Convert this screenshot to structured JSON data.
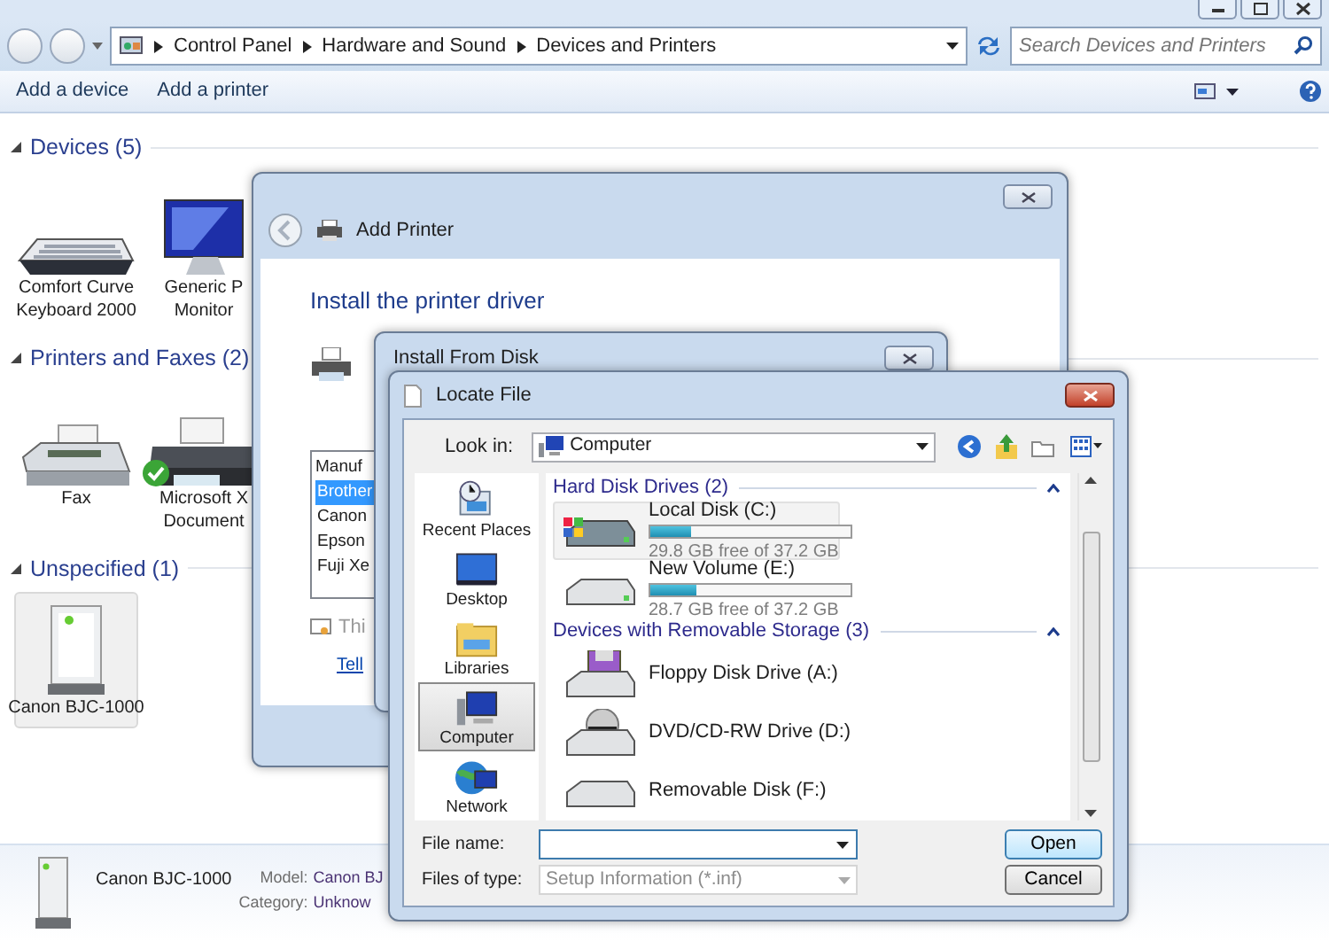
{
  "explorer": {
    "breadcrumb": [
      "Control Panel",
      "Hardware and Sound",
      "Devices and Printers"
    ],
    "search": {
      "placeholder": "Search Devices and Printers"
    },
    "toolbar": [
      "Add a device",
      "Add a printer"
    ],
    "groups": [
      {
        "title": "Devices (5)",
        "expanded": true,
        "items": [
          {
            "lines": [
              "Comfort Curve",
              "Keyboard 2000"
            ],
            "kind": "keyboard",
            "selected": false,
            "default": false
          },
          {
            "lines": [
              "Generic P",
              "Monitor"
            ],
            "kind": "monitor",
            "selected": false,
            "default": false
          }
        ]
      },
      {
        "title": "Printers and Faxes (2)",
        "expanded": true,
        "items": [
          {
            "lines": [
              "Fax"
            ],
            "kind": "fax",
            "selected": false,
            "default": false
          },
          {
            "lines": [
              "Microsoft X",
              "Document"
            ],
            "kind": "printer",
            "selected": false,
            "default": true
          }
        ]
      },
      {
        "title": "Unspecified (1)",
        "expanded": true,
        "items": [
          {
            "lines": [
              "Canon BJC-1000"
            ],
            "kind": "tower",
            "selected": true,
            "default": false
          }
        ]
      }
    ],
    "details": {
      "name": "Canon BJC-1000",
      "fields": [
        {
          "label": "Model:",
          "value": "Canon BJ"
        },
        {
          "label": "Category:",
          "value": "Unknow"
        }
      ]
    }
  },
  "add_printer": {
    "title": "Add Printer",
    "heading": "Install the printer driver",
    "list_header": "Manuf",
    "manufacturers": [
      {
        "label": "Brother",
        "selected": true
      },
      {
        "label": "Canon",
        "selected": false
      },
      {
        "label": "Epson",
        "selected": false
      },
      {
        "label": "Fuji Xe",
        "selected": false
      }
    ],
    "note": "Thi",
    "link": "Tell"
  },
  "install_from_disk": {
    "title": "Install From Disk"
  },
  "locate_file": {
    "title": "Locate File",
    "look_in_label": "Look in:",
    "look_in": "Computer",
    "places": [
      {
        "label": "Recent Places",
        "kind": "recent",
        "selected": false
      },
      {
        "label": "Desktop",
        "kind": "desktop",
        "selected": false
      },
      {
        "label": "Libraries",
        "kind": "libraries",
        "selected": false
      },
      {
        "label": "Computer",
        "kind": "computer",
        "selected": true
      },
      {
        "label": "Network",
        "kind": "network",
        "selected": false
      }
    ],
    "groups": [
      {
        "title": "Hard Disk Drives (2)",
        "items": [
          {
            "name": "Local Disk (C:)",
            "kind": "system",
            "level": 0.2,
            "free": "29.8 GB free of 37.2 GB",
            "selected": true
          },
          {
            "name": "New Volume (E:)",
            "kind": "disk",
            "level": 0.23,
            "free": "28.7 GB free of 37.2 GB",
            "selected": false
          }
        ]
      },
      {
        "title": "Devices with Removable Storage (3)",
        "items": [
          {
            "name": "Floppy Disk Drive (A:)",
            "kind": "floppy",
            "selected": false
          },
          {
            "name": "DVD/CD-RW Drive (D:)",
            "kind": "dvd",
            "selected": false
          },
          {
            "name": "Removable Disk (F:)",
            "kind": "removable",
            "selected": false
          }
        ]
      }
    ],
    "file_name_label": "File name:",
    "files_of_type_label": "Files of type:",
    "file_type": "Setup Information (*.inf)",
    "file_type_disabled": true,
    "buttons": [
      "Open",
      "Cancel"
    ]
  }
}
